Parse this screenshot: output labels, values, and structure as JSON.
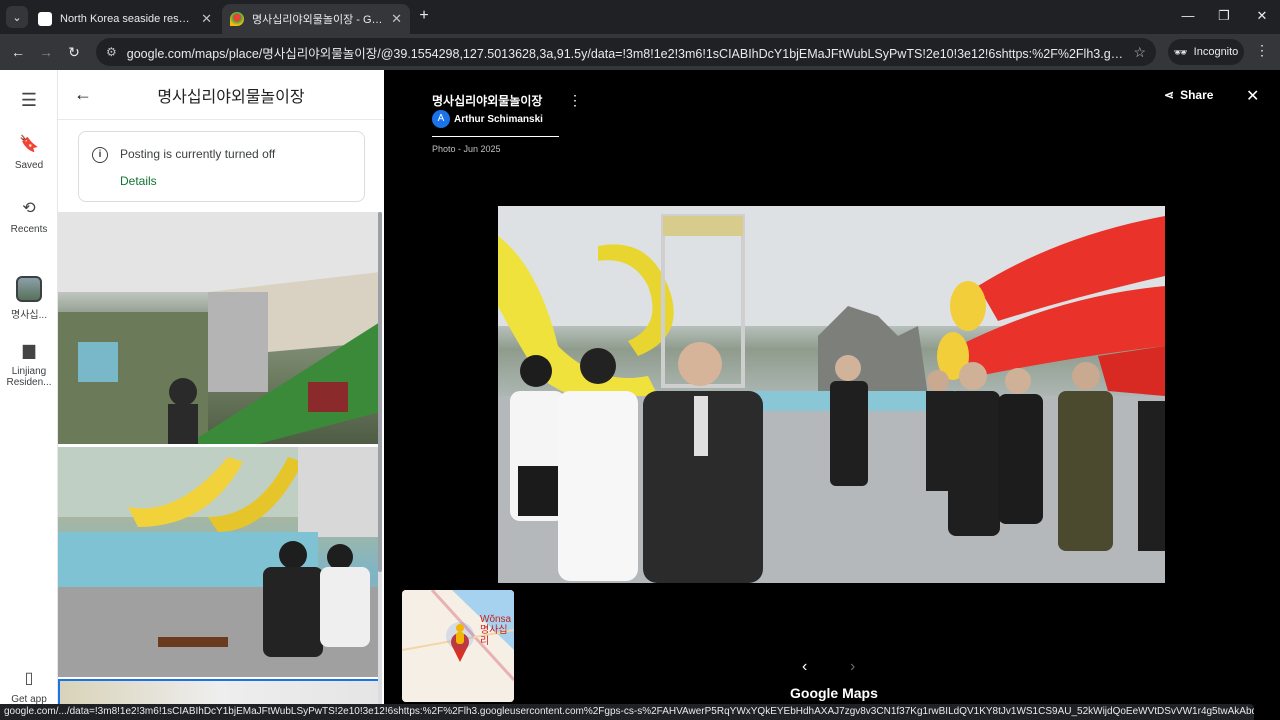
{
  "browser": {
    "tabs": [
      {
        "title": "North Korea seaside resort ban",
        "active": false
      },
      {
        "title": "명사십리야외물놀이장 - Google",
        "active": true
      }
    ],
    "new_tab_label": "+",
    "url": "google.com/maps/place/명사십리야외물놀이장/@39.1554298,127.5013628,3a,91.5y/data=!3m8!1e2!3m6!1sCIABIhDcY1bjEMaJFtWubLSyPwTS!2e10!3e12!6shttps:%2F%2Flh3.googleusercontent.com%...",
    "incognito_label": "Incognito",
    "status_url": "google.com/.../data=!3m8!1e2!3m6!1sCIABIhDcY1bjEMaJFtWubLSyPwTS!2e10!3e12!6shttps:%2F%2Flh3.googleusercontent.com%2Fgps-cs-s%2FAHVAwerP5RqYWxYQkEYEbHdhAXAJ7zgv8v3CN1f37Kg1rwBILdQV1KY8tJv1WS1CS9AU_52kWijdQoEeWVtDSvVW1r4g5twAkAbqXku_YqaEzuh67v2rx..."
  },
  "rail": {
    "items": [
      {
        "label": "Saved",
        "icon": "bookmark-icon"
      },
      {
        "label": "Recents",
        "icon": "history-icon"
      },
      {
        "label": "명사십...",
        "icon": "place-thumbnail"
      },
      {
        "label": "Linjiang Residen...",
        "icon": "building-icon"
      },
      {
        "label": "Get app",
        "icon": "phone-icon"
      }
    ]
  },
  "panel": {
    "title": "명사십리야외물놀이장",
    "notice": {
      "message": "Posting is currently turned off",
      "link": "Details"
    }
  },
  "viewer": {
    "title": "명사십리야외물놀이장",
    "author_initial": "A",
    "author": "Arthur Schimanski",
    "date": "Photo - Jun 2025",
    "share_label": "Share",
    "minimap_label_latin": "Wŏnsa",
    "minimap_label_korean": "명사십리",
    "brand": "Google Maps"
  }
}
